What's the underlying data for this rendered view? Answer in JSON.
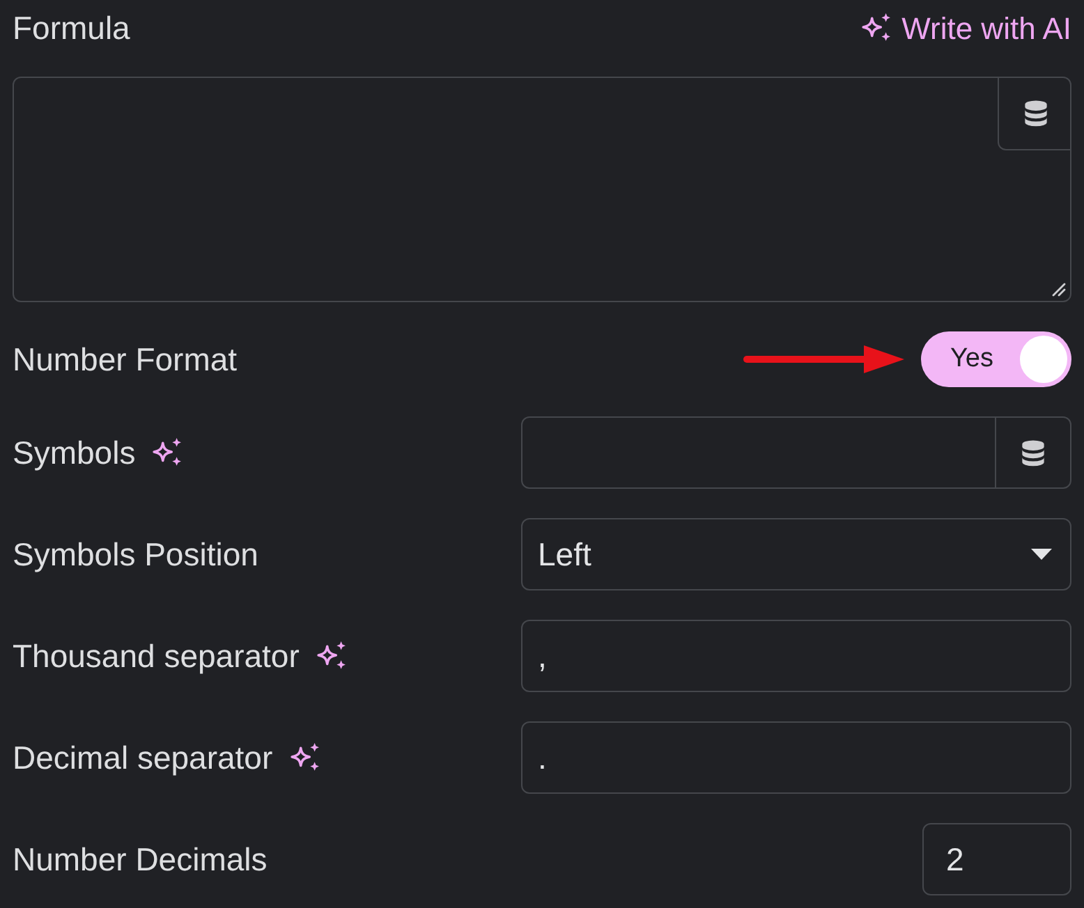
{
  "formula": {
    "label": "Formula",
    "ai_action": "Write with AI"
  },
  "fields": [
    {
      "kind": "toggle",
      "label": "Number Format",
      "ai": false,
      "on": true,
      "value": "Yes",
      "pointed_at": true
    },
    {
      "kind": "dynamic",
      "label": "Symbols",
      "ai": true
    },
    {
      "kind": "select",
      "label": "Symbols Position",
      "ai": false,
      "value": "Left"
    },
    {
      "kind": "text",
      "label": "Thousand separator",
      "ai": true,
      "value": ","
    },
    {
      "kind": "text",
      "label": "Decimal separator",
      "ai": true,
      "value": "."
    },
    {
      "kind": "number",
      "label": "Number Decimals",
      "ai": false,
      "value": "2"
    }
  ]
}
